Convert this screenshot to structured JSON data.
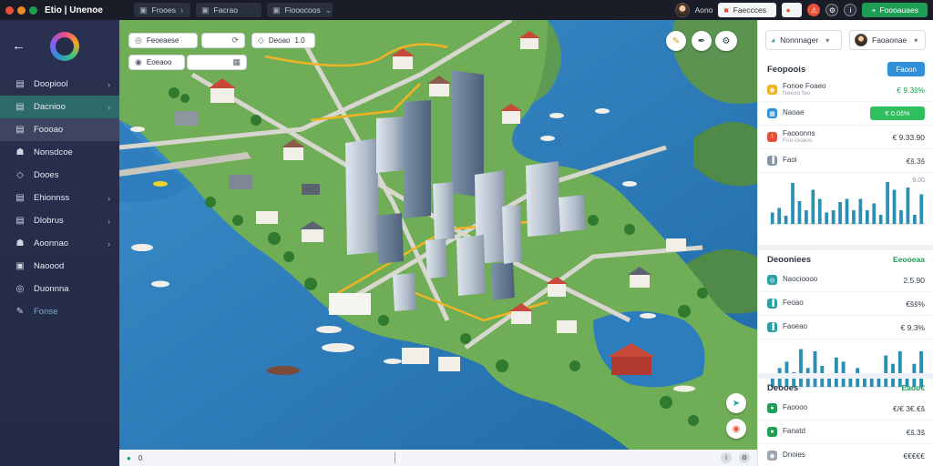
{
  "topbar": {
    "app_title": "Etio | Unenoe",
    "chips": [
      {
        "icon": "document-icon",
        "label": "Frooes",
        "chevron": "›"
      },
      {
        "icon": "document-icon",
        "label": "Facrao"
      },
      {
        "icon": "document-icon",
        "label": "Fiooocoos",
        "chevron": "⌄"
      }
    ],
    "user_name": "Aono",
    "center_field": "Faeccces",
    "action_label": "Foooauaes",
    "colors": {
      "green": "#1e9e55",
      "red": "#e8503a",
      "orange": "#f08a24"
    }
  },
  "sidebar": {
    "items": [
      {
        "icon": "folder-icon",
        "label": "Doopiool",
        "chevron": "›"
      },
      {
        "icon": "folder-icon",
        "label": "Dacnioo",
        "chevron": "›",
        "state": "active"
      },
      {
        "icon": "folder-icon",
        "label": "Foooao",
        "state": "hover"
      },
      {
        "icon": "people-icon",
        "label": "Nonsdcoe"
      },
      {
        "icon": "tag-icon",
        "label": "Dooes"
      },
      {
        "icon": "folder-icon",
        "label": "Ehionnss",
        "chevron": "›"
      },
      {
        "icon": "folder-icon",
        "label": "Dlobrus",
        "chevron": "›"
      },
      {
        "icon": "people-icon",
        "label": "Aoonnao",
        "chevron": "›"
      },
      {
        "icon": "document-icon",
        "label": "Naoood"
      },
      {
        "icon": "globe-icon",
        "label": "Duonnna"
      },
      {
        "icon": "brush-icon",
        "label": "Fonse",
        "state": "muted"
      }
    ]
  },
  "map": {
    "chips": [
      {
        "icon": "target-icon",
        "label": "Feoeaese"
      },
      {
        "icon": "sync-icon",
        "label": ""
      },
      {
        "icon": "layers-icon",
        "label": "Deoao",
        "suffix": "1.0"
      },
      {
        "icon": "pin-icon",
        "label": "Eoeaoo"
      },
      {
        "icon": "grid-icon",
        "label": ""
      }
    ],
    "footer": {
      "left": "0",
      "right_icons": [
        "info-icon",
        "settings-icon"
      ]
    }
  },
  "panel": {
    "selector_1": "Nonnnager",
    "selector_2": "Faoaonae",
    "section1": {
      "title": "Feopoois",
      "button": "Faoon",
      "rows": [
        {
          "icon": "coin-icon",
          "color": "#f0b323",
          "label": "Fonoe Foaeo",
          "sub": "Neeoo foo",
          "value": "€ 9.3š%",
          "green": true
        },
        {
          "icon": "wallet-icon",
          "color": "#2f8fd8",
          "label": "Naoae",
          "pill": "€ 0.0š%"
        },
        {
          "icon": "alert-icon",
          "color": "#e8503a",
          "label": "Faooonns",
          "sub": "Foo iooaoo",
          "value": "€ 9.33.90"
        },
        {
          "icon": "chart-icon",
          "color": "#8a95a3",
          "label": "Faoi",
          "value": "€š.3š"
        }
      ],
      "chart": {
        "values": [
          0.25,
          0.35,
          0.18,
          0.9,
          0.5,
          0.3,
          0.75,
          0.55,
          0.25,
          0.3,
          0.48,
          0.55,
          0.3,
          0.55,
          0.3,
          0.45,
          0.2,
          0.92,
          0.75,
          0.3,
          0.8,
          0.2,
          0.65
        ],
        "top_right": "9.00"
      }
    },
    "section2": {
      "title": "Deooniees",
      "badge": "Eeooeaa",
      "rows": [
        {
          "icon": "target-icon",
          "color": "#2aa0a6",
          "label": "Naocioooo",
          "value": "2.5.90"
        },
        {
          "icon": "chart-icon",
          "color": "#2aa0a6",
          "label": "Feoao",
          "value": "€šš%"
        },
        {
          "icon": "chart-icon",
          "color": "#2aa0a6",
          "label": "Faoeao",
          "value": "€ 9.3%"
        }
      ],
      "chart": {
        "values": [
          0.2,
          0.45,
          0.6,
          0.35,
          0.9,
          0.45,
          0.85,
          0.5,
          0.3,
          0.7,
          0.6,
          0.3,
          0.45,
          0.2,
          0.3,
          0.25,
          0.75,
          0.55,
          0.85,
          0.3,
          0.55,
          0.85
        ]
      }
    },
    "section3": {
      "title": "Deooes",
      "badge": "Eaoo€",
      "rows": [
        {
          "icon": "dot-icon",
          "color": "#1e9e55",
          "label": "Faoooo",
          "value": "€/€ 3€.€š"
        },
        {
          "icon": "dot-icon",
          "color": "#1e9e55",
          "label": "Fanatd",
          "value": "€š.3š"
        },
        {
          "icon": "coin-icon",
          "color": "#9aa3ae",
          "label": "Dnoies",
          "value": "€€€€€"
        }
      ]
    }
  }
}
